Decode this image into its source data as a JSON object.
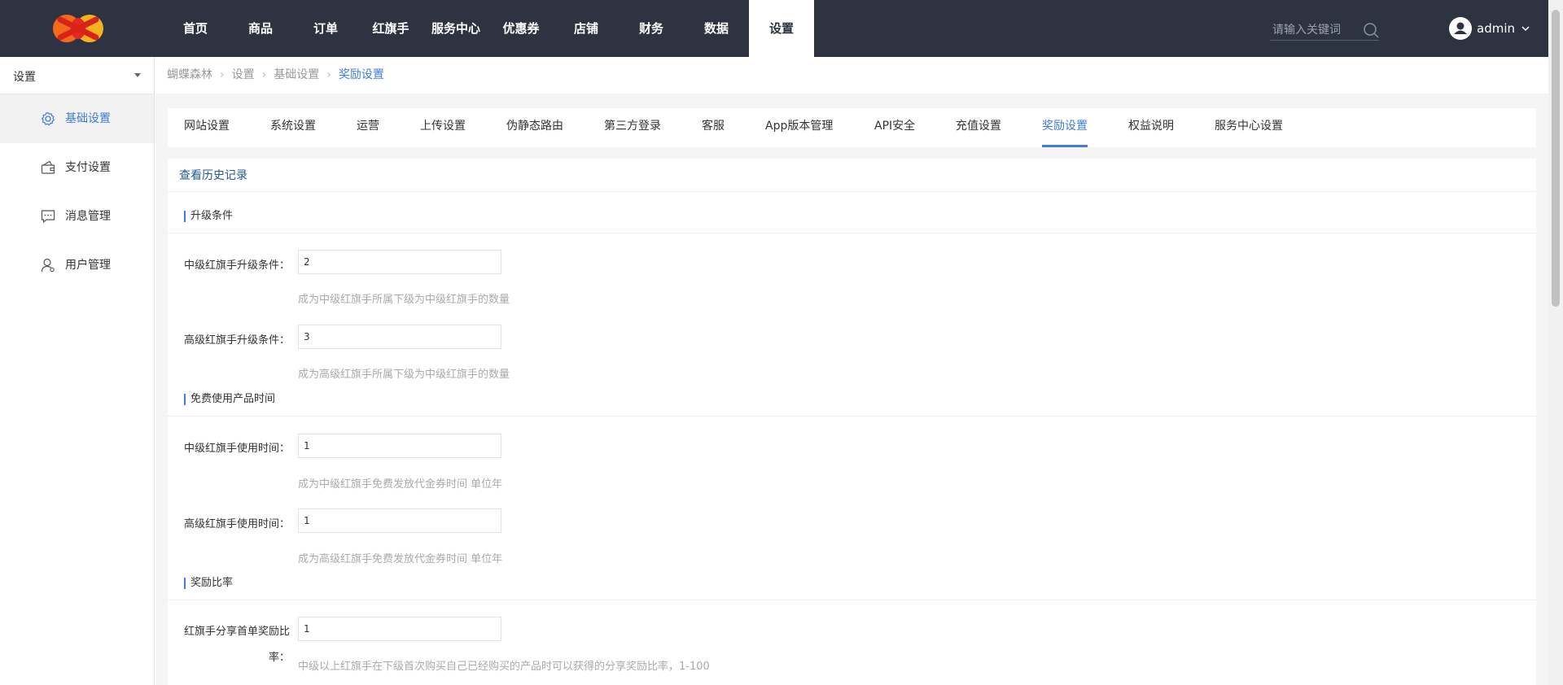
{
  "header": {
    "nav": [
      "首页",
      "商品",
      "订单",
      "红旗手",
      "服务中心",
      "优惠券",
      "店铺",
      "财务",
      "数据",
      "设置"
    ],
    "active_nav_index": 9,
    "search_placeholder": "请输入关键词",
    "username": "admin"
  },
  "sidebar": {
    "select_label": "设置",
    "items": [
      {
        "label": "基础设置",
        "icon": "gear-icon",
        "active": true
      },
      {
        "label": "支付设置",
        "icon": "wallet-icon",
        "active": false
      },
      {
        "label": "消息管理",
        "icon": "message-icon",
        "active": false
      },
      {
        "label": "用户管理",
        "icon": "user-icon",
        "active": false
      }
    ]
  },
  "breadcrumb": [
    "蝴蝶森林",
    "设置",
    "基础设置",
    "奖励设置"
  ],
  "tabs": [
    "网站设置",
    "系统设置",
    "运营",
    "上传设置",
    "伪静态路由",
    "第三方登录",
    "客服",
    "App版本管理",
    "API安全",
    "充值设置",
    "奖励设置",
    "权益说明",
    "服务中心设置"
  ],
  "active_tab_index": 10,
  "panel": {
    "history_link": "查看历史记录",
    "sections": [
      {
        "title": "升级条件"
      },
      {
        "title": "免费使用产品时间"
      },
      {
        "title": "奖励比率"
      }
    ],
    "fields": [
      {
        "label": "中级红旗手升级条件：",
        "value": "2",
        "help": "成为中级红旗手所属下级为中级红旗手的数量"
      },
      {
        "label": "高级红旗手升级条件：",
        "value": "3",
        "help": "成为高级红旗手所属下级为中级红旗手的数量"
      },
      {
        "label": "中级红旗手使用时间：",
        "value": "1",
        "help": "成为中级红旗手免费发放代金券时间 单位年"
      },
      {
        "label": "高级红旗手使用时间：",
        "value": "1",
        "help": "成为高级红旗手免费发放代金券时间 单位年"
      },
      {
        "label_line1": "红旗手分享首单奖励比",
        "label_line2": "率：",
        "value": "1",
        "help": "中级以上红旗手在下级首次购买自己已经购买的产品时可以获得的分享奖励比率，1-100"
      }
    ]
  },
  "colors": {
    "header_bg": "#2d3340",
    "accent": "#3f7cdc",
    "link": "#225b9c"
  }
}
